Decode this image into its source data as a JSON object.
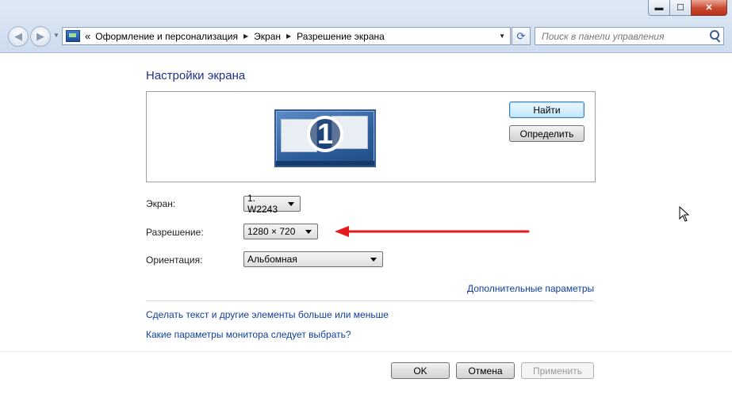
{
  "window": {
    "minimize_glyph": "▬",
    "maximize_glyph": "☐",
    "close_glyph": "✕"
  },
  "nav": {
    "back_glyph": "◀",
    "forward_glyph": "▶",
    "recent_glyph": "▼"
  },
  "address_bar": {
    "overflow_glyph": "«",
    "crumbs": [
      "Оформление и персонализация",
      "Экран",
      "Разрешение экрана"
    ],
    "separator": "▶",
    "dropdown_glyph": "▼",
    "refresh_glyph": "⟳"
  },
  "search": {
    "placeholder": "Поиск в панели управления"
  },
  "main": {
    "title": "Настройки экрана",
    "monitor_number": "1",
    "find_button": "Найти",
    "identify_button": "Определить",
    "screen_label": "Экран:",
    "screen_value": "1. W2243",
    "resolution_label": "Разрешение:",
    "resolution_value": "1280 × 720",
    "orientation_label": "Ориентация:",
    "orientation_value": "Альбомная",
    "advanced_link": "Дополнительные параметры",
    "text_size_link": "Сделать текст и другие элементы больше или меньше",
    "which_settings_link": "Какие параметры монитора следует выбрать?"
  },
  "footer": {
    "ok": "OK",
    "cancel": "Отмена",
    "apply": "Применить"
  },
  "colors": {
    "title_blue": "#1e3287",
    "link_blue": "#0d3e9e",
    "arrow_red": "#e8171b"
  }
}
